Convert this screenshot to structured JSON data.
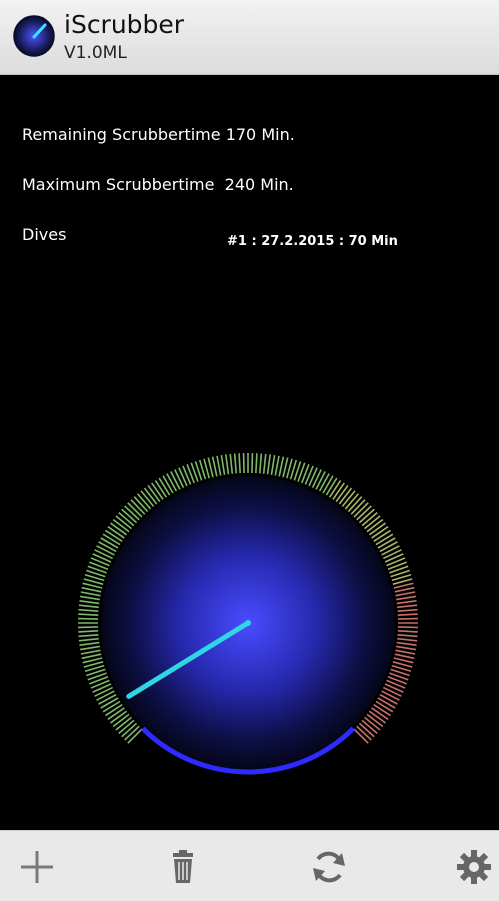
{
  "app": {
    "title": "iScrubber",
    "version": "V1.0ML"
  },
  "info": {
    "remaining_label": "Remaining Scrubbertime 170 Min.",
    "maximum_label": "Maximum Scrubbertime  240 Min.",
    "dives_label": "Dives"
  },
  "dives": [
    {
      "text": "#1 : 27.2.2015 : 70 Min"
    }
  ],
  "gauge": {
    "value_min": 170,
    "max_min": 240,
    "colors": {
      "good": "#7fb86a",
      "mid": "#a9b56a",
      "low": "#c4716b",
      "needle": "#2fd6e6",
      "dial": "#4a4cff",
      "rim": "#2d2bff"
    }
  },
  "toolbar": {
    "add_icon": "plus-icon",
    "delete_icon": "trash-icon",
    "refresh_icon": "refresh-icon",
    "settings_icon": "gear-icon"
  }
}
